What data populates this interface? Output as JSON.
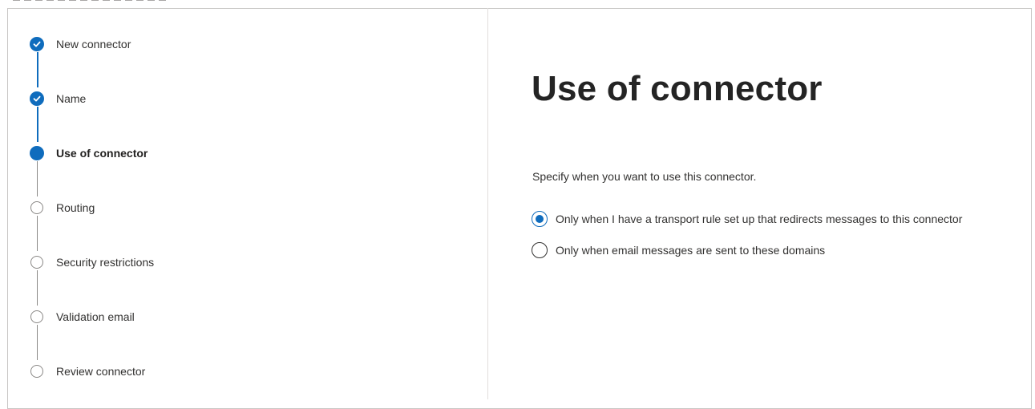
{
  "wizard": {
    "steps": [
      {
        "label": "New connector",
        "status": "completed",
        "icon": "checkmark-icon"
      },
      {
        "label": "Name",
        "status": "completed",
        "icon": "checkmark-icon"
      },
      {
        "label": "Use of connector",
        "status": "current",
        "icon": "filled-circle-icon"
      },
      {
        "label": "Routing",
        "status": "pending",
        "icon": "empty-circle-icon"
      },
      {
        "label": "Security restrictions",
        "status": "pending",
        "icon": "empty-circle-icon"
      },
      {
        "label": "Validation email",
        "status": "pending",
        "icon": "empty-circle-icon"
      },
      {
        "label": "Review connector",
        "status": "pending",
        "icon": "empty-circle-icon"
      }
    ]
  },
  "main": {
    "title": "Use of connector",
    "description": "Specify when you want to use this connector.",
    "options": [
      {
        "label": "Only when I have a transport rule set up that redirects messages to this connector",
        "selected": true
      },
      {
        "label": "Only when email messages are sent to these domains",
        "selected": false
      }
    ]
  },
  "colors": {
    "accent": "#0f6cbd",
    "pending": "#8a8886",
    "text": "#323130"
  }
}
